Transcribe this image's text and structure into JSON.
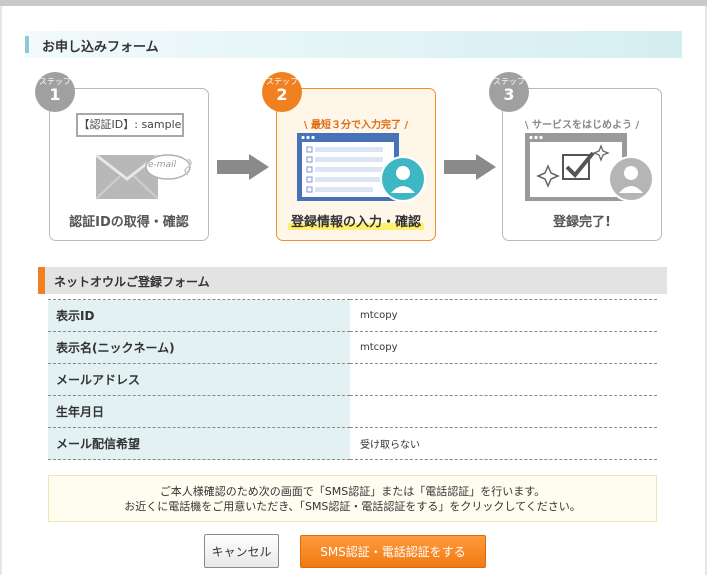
{
  "form_title": "お申し込みフォーム",
  "steps": [
    {
      "badge_label": "ステップ",
      "number": "1",
      "caption": "【認証ID】: sample",
      "label": "認証IDの取得・確認"
    },
    {
      "badge_label": "ステップ",
      "number": "2",
      "caption": "最短３分で入力完了",
      "label": "登録情報の入力・確認"
    },
    {
      "badge_label": "ステップ",
      "number": "3",
      "caption": "サービスをはじめよう",
      "label": "登録完了!"
    }
  ],
  "email_tag": "e-mail",
  "section_title": "ネットオウルご登録フォーム",
  "rows": [
    {
      "label": "表示ID",
      "value": "mtcopy"
    },
    {
      "label": "表示名(ニックネーム)",
      "value": "mtcopy"
    },
    {
      "label": "メールアドレス",
      "value": ""
    },
    {
      "label": "生年月日",
      "value": ""
    },
    {
      "label": "メール配信希望",
      "value": "受け取らない"
    }
  ],
  "notice": {
    "line1": "ご本人様確認のため次の画面で「SMS認証」または「電話認証」を行います。",
    "line2": "お近くに電話機をご用意いただき、「SMS認証・電話認証をする」をクリックしてください。"
  },
  "buttons": {
    "cancel": "キャンセル",
    "sms": "SMS認証・電話認証をする"
  },
  "colors": {
    "accent": "#f08020",
    "title_bg": "#d5eef2",
    "label_bg": "#e3f1f2"
  }
}
